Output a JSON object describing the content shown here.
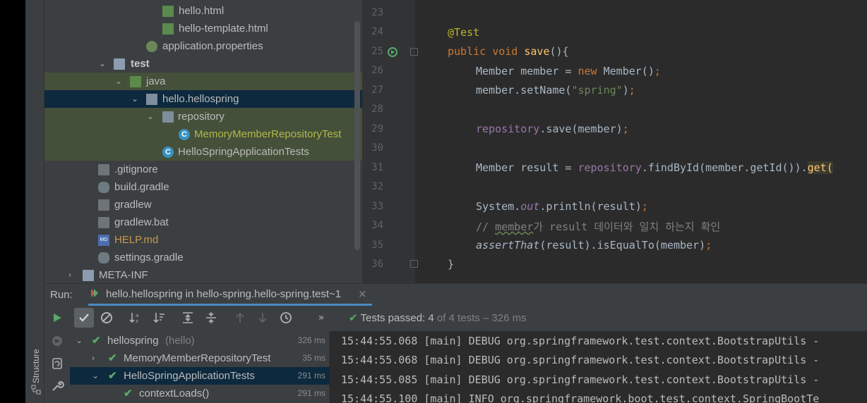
{
  "project_tree": {
    "rows": [
      {
        "label": "hello.html"
      },
      {
        "label": "hello-template.html"
      },
      {
        "label": "application.properties"
      },
      {
        "label": "test"
      },
      {
        "label": "java"
      },
      {
        "label": "hello.hellospring"
      },
      {
        "label": "repository"
      },
      {
        "label": "MemoryMemberRepositoryTest"
      },
      {
        "label": "HelloSpringApplicationTests"
      },
      {
        "label": ".gitignore"
      },
      {
        "label": "build.gradle"
      },
      {
        "label": "gradlew"
      },
      {
        "label": "gradlew.bat"
      },
      {
        "label": "HELP.md"
      },
      {
        "label": "settings.gradle"
      },
      {
        "label": "META-INF"
      }
    ]
  },
  "editor": {
    "line_numbers": [
      "23",
      "24",
      "25",
      "26",
      "27",
      "28",
      "29",
      "30",
      "31",
      "32",
      "33",
      "34",
      "35",
      "36"
    ],
    "code": {
      "l24_annot": "@Test",
      "l25_kw1": "public",
      "l25_kw2": "void",
      "l25_fn": "save",
      "l25_rest": "(){",
      "l26_a": "Member member = ",
      "l26_new": "new",
      "l26_b": " Member()",
      "l26_semi": ";",
      "l27_a": "member.setName(",
      "l27_str": "\"spring\"",
      "l27_b": ")",
      "l27_semi": ";",
      "l29_field": "repository",
      "l29_b": ".save(member)",
      "l29_semi": ";",
      "l31_a": "Member result = ",
      "l31_field": "repository",
      "l31_b": ".findById(member.getId()).",
      "l31_get": "get(",
      "l33_a": "System.",
      "l33_out": "out",
      "l33_b": ".println(result)",
      "l33_semi": ";",
      "l34_cmt1": "// ",
      "l34_cmt_u": "member",
      "l34_cmt2": "가 result 데이터와 일치 하는지 확인",
      "l35_assert": "assertThat",
      "l35_b": "(result).isEqualTo(member)",
      "l35_semi": ";",
      "l36": "}"
    }
  },
  "run_panel": {
    "run_label": "Run:",
    "tab_title": "hello.hellospring in hello-spring.hello-spring.test~1",
    "tab_close": "×",
    "more": "»",
    "status_prefix": "Tests passed: ",
    "status_count": "4",
    "status_of": " of 4 tests – 326 ms"
  },
  "test_tree": {
    "rows": [
      {
        "label": "hellospring",
        "suffix": " (hello)",
        "time": "326 ms"
      },
      {
        "label": "MemoryMemberRepositoryTest",
        "suffix": "",
        "time": "35 ms"
      },
      {
        "label": "HelloSpringApplicationTests",
        "suffix": "",
        "time": "291 ms"
      },
      {
        "label": "contextLoads()",
        "suffix": "",
        "time": "291 ms"
      }
    ]
  },
  "console": {
    "lines": [
      "15:44:55.068 [main] DEBUG org.springframework.test.context.BootstrapUtils -",
      "15:44:55.068 [main] DEBUG org.springframework.test.context.BootstrapUtils -",
      "15:44:55.085 [main] DEBUG org.springframework.test.context.BootstrapUtils -",
      "15:44:55.100 [main] INFO org.springframework.boot.test.context.SpringBootTe"
    ]
  },
  "sidebar": {
    "structure_label": "Structure"
  },
  "colors": {
    "accent": "#4a88c7",
    "pass_green": "#59a869",
    "selection": "#0d293e"
  }
}
